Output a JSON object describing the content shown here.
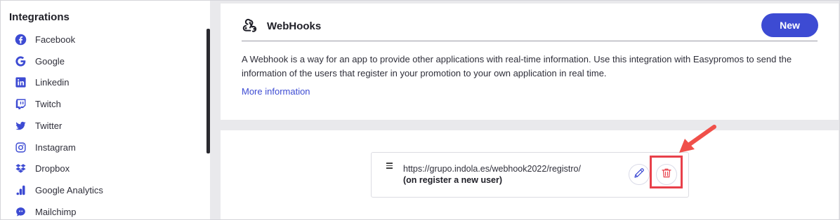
{
  "sidebar": {
    "title": "Integrations",
    "items": [
      {
        "label": "Facebook",
        "icon": "facebook-icon"
      },
      {
        "label": "Google",
        "icon": "google-icon"
      },
      {
        "label": "Linkedin",
        "icon": "linkedin-icon"
      },
      {
        "label": "Twitch",
        "icon": "twitch-icon"
      },
      {
        "label": "Twitter",
        "icon": "twitter-icon"
      },
      {
        "label": "Instagram",
        "icon": "instagram-icon"
      },
      {
        "label": "Dropbox",
        "icon": "dropbox-icon"
      },
      {
        "label": "Google Analytics",
        "icon": "google-analytics-icon"
      },
      {
        "label": "Mailchimp",
        "icon": "mailchimp-icon"
      }
    ]
  },
  "webhooks_card": {
    "title": "WebHooks",
    "new_button_label": "New",
    "description": "A Webhook is a way for an app to provide other applications with real-time information. Use this integration with Easypromos to send the information of the users that register in your promotion to your own application in real time.",
    "more_link": "More information"
  },
  "webhook_list": {
    "items": [
      {
        "url": "https://grupo.indola.es/webhook2022/registro/",
        "trigger": "(on register a new user)"
      }
    ]
  },
  "colors": {
    "accent": "#3d4bd3",
    "icon_blue": "#3d4bd3",
    "delete_red": "#e8404a",
    "annotation": "#f0504a"
  }
}
